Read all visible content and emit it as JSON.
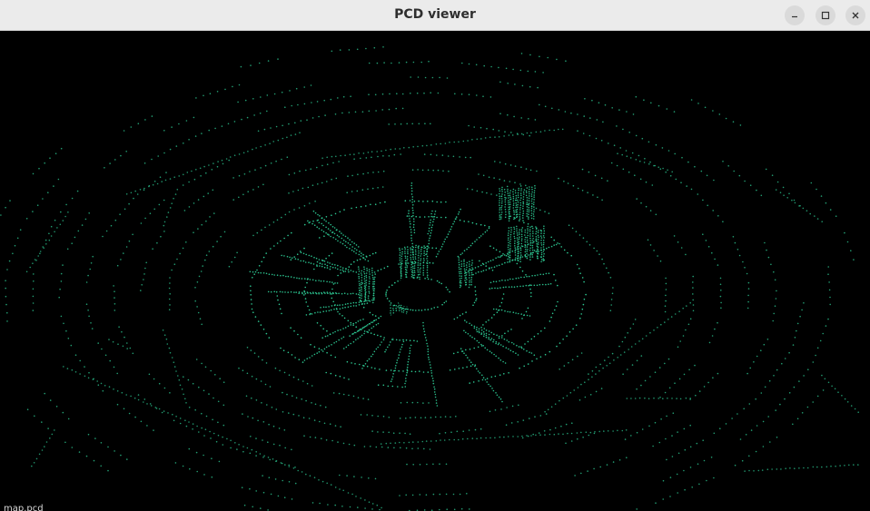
{
  "window": {
    "title": "PCD viewer",
    "controls": {
      "minimize_icon": "minimize-icon",
      "maximize_icon": "maximize-icon",
      "close_icon": "close-icon"
    }
  },
  "viewer": {
    "background_color": "#000000",
    "point_color": "#2fd39a",
    "status_text": "map.pcd"
  }
}
